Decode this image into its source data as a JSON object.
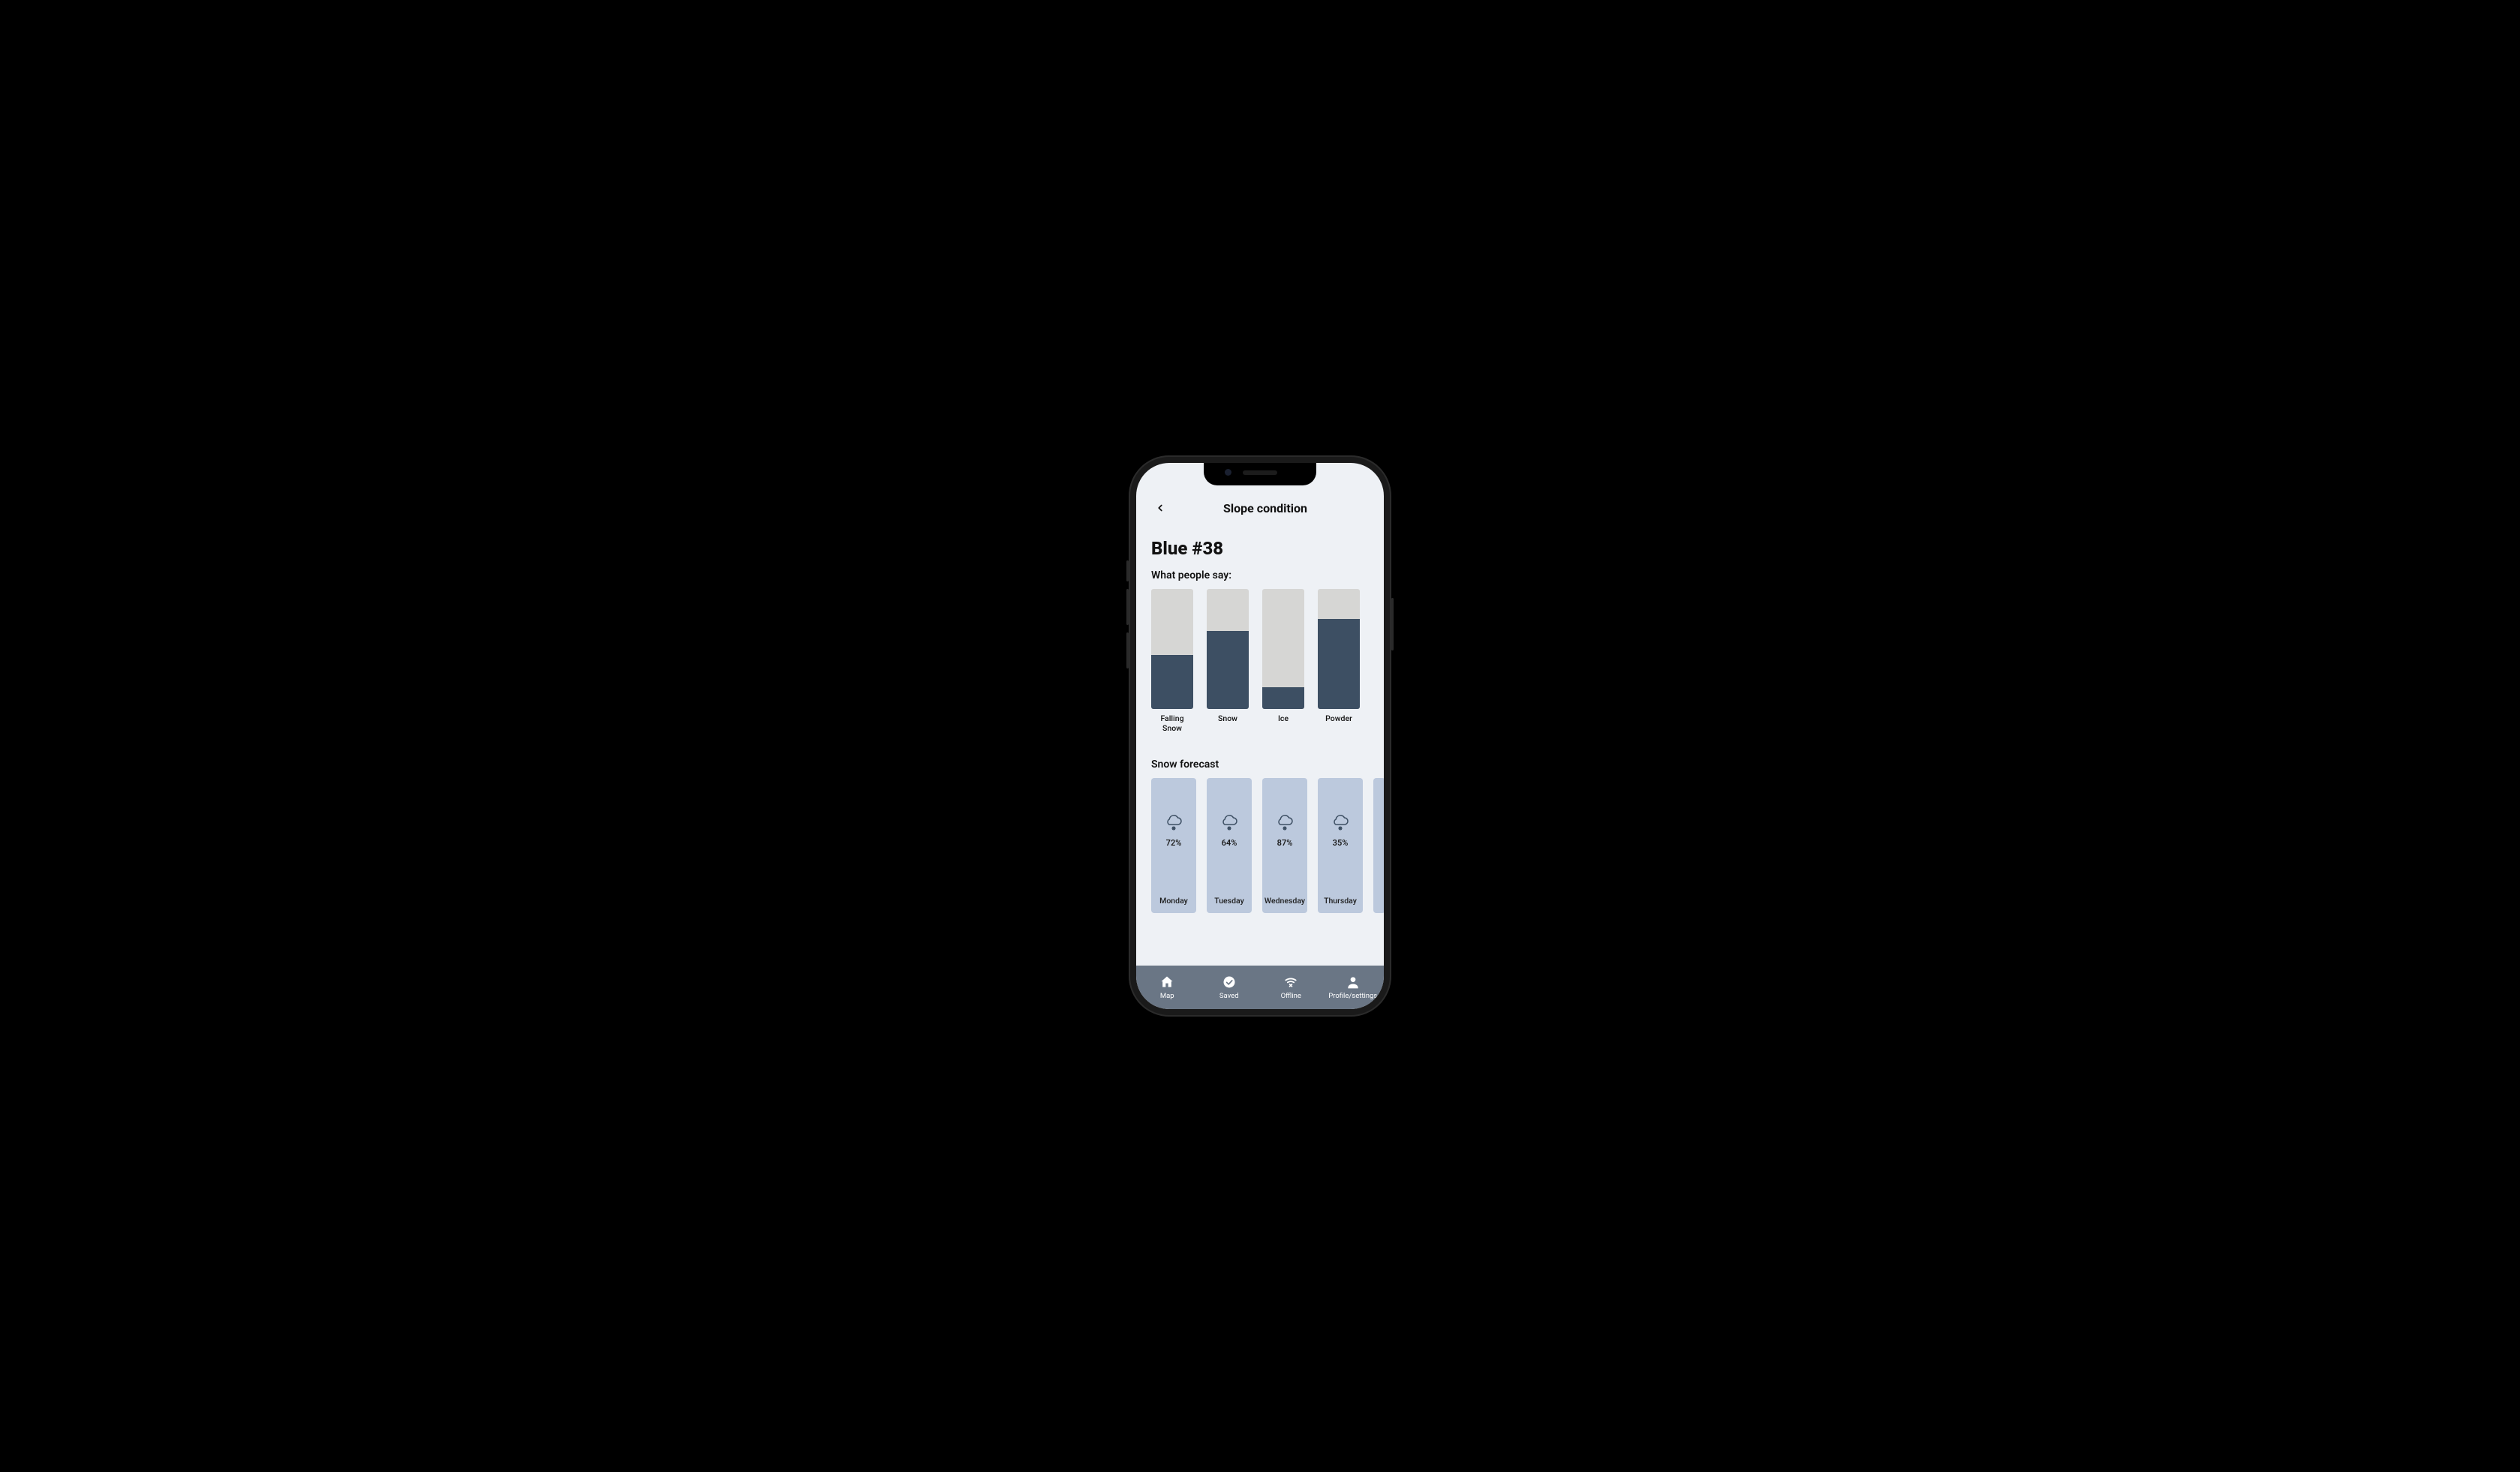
{
  "header": {
    "title": "Slope condition"
  },
  "slope": {
    "name": "Blue #38"
  },
  "peopleSay": {
    "heading": "What people say:"
  },
  "chart_data": {
    "type": "bar",
    "title": "What people say:",
    "xlabel": "",
    "ylabel": "",
    "ylim": [
      0,
      100
    ],
    "categories": [
      "Falling Snow",
      "Snow",
      "Ice",
      "Powder"
    ],
    "values": [
      45,
      65,
      18,
      75
    ]
  },
  "forecast": {
    "heading": "Snow forecast",
    "days": [
      {
        "day": "Monday",
        "pct": "72%"
      },
      {
        "day": "Tuesday",
        "pct": "64%"
      },
      {
        "day": "Wednesday",
        "pct": "87%"
      },
      {
        "day": "Thursday",
        "pct": "35%"
      }
    ]
  },
  "tabs": {
    "map": "Map",
    "saved": "Saved",
    "offline": "Offline",
    "profile": "Profile/settings"
  },
  "colors": {
    "barFill": "#3d4f63",
    "barTrack": "#d6d6d4",
    "forecastCard": "#bcc9dd",
    "tabbar": "#6a7685",
    "screenBg": "#eef1f5"
  }
}
